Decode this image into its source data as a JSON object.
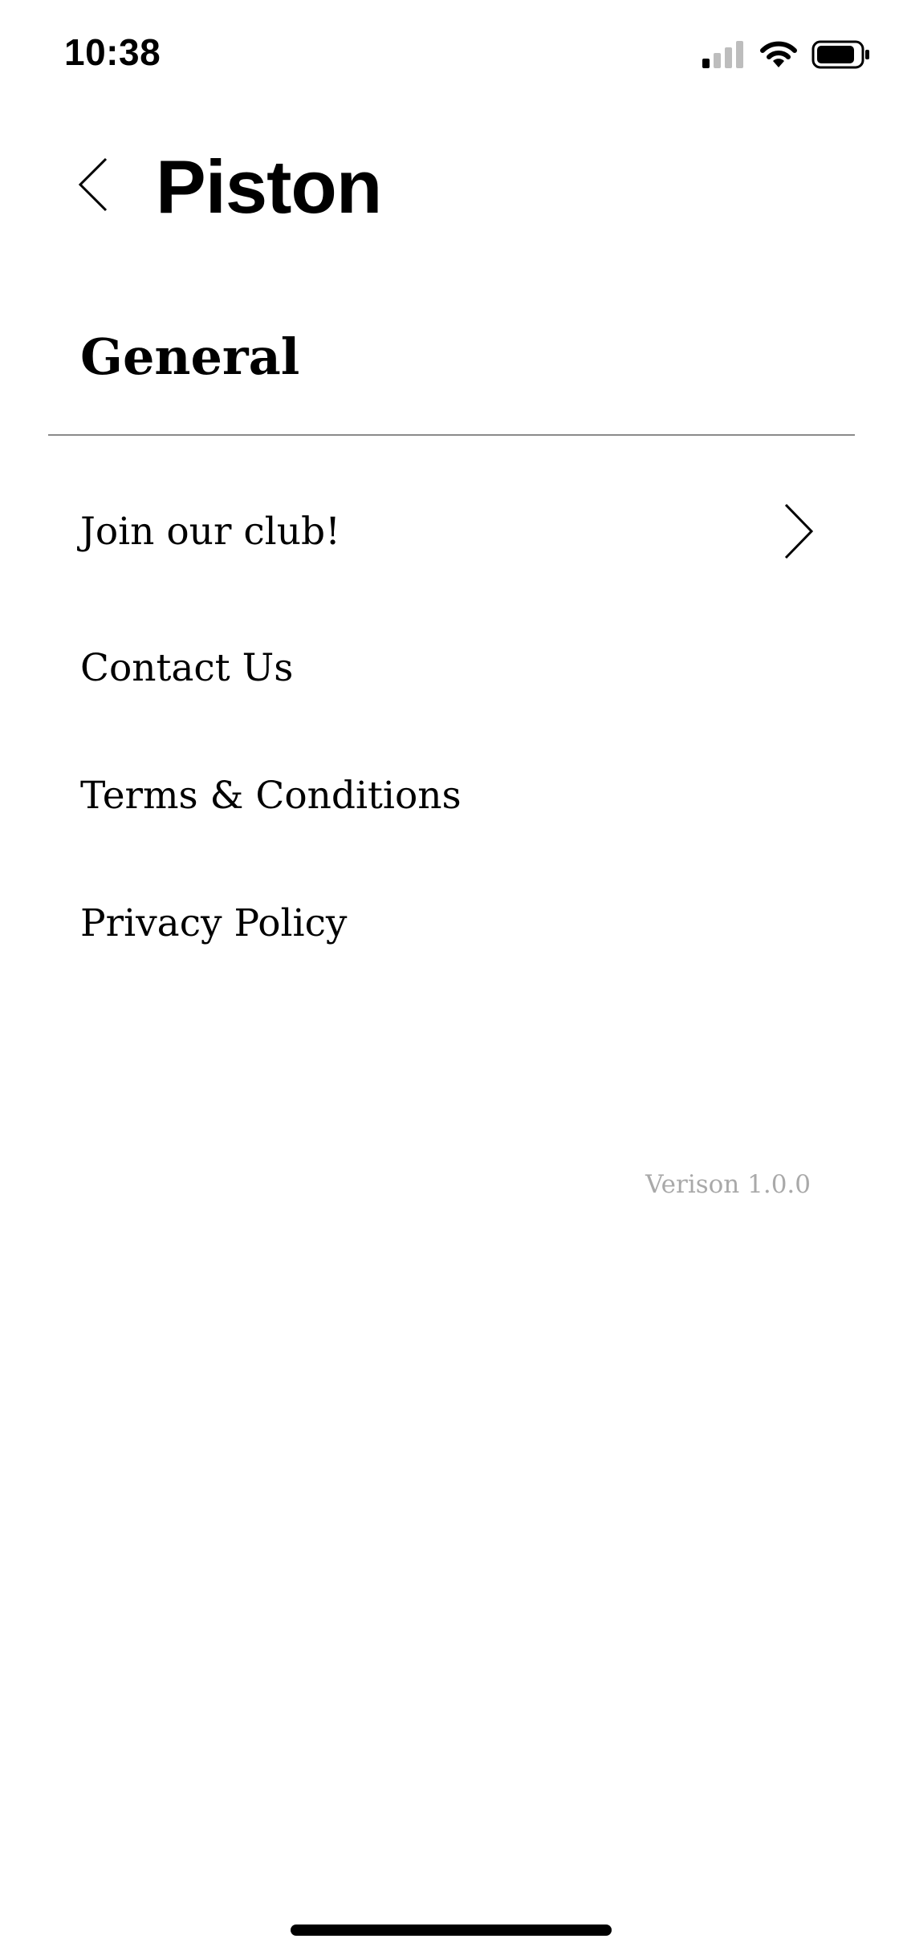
{
  "status_bar": {
    "time": "10:38",
    "icons": [
      "cellular-signal-icon",
      "wifi-icon",
      "battery-icon"
    ]
  },
  "header": {
    "back_icon": "chevron-left-icon",
    "title": "Piston"
  },
  "section": {
    "title": "General"
  },
  "menu": {
    "items": [
      {
        "label": "Join our club!",
        "icon": "chevron-right-icon"
      },
      {
        "label": "Contact Us"
      },
      {
        "label": "Terms & Conditions"
      },
      {
        "label": "Privacy Policy"
      }
    ]
  },
  "footer": {
    "version": "Verison 1.0.0"
  },
  "colors": {
    "background": "#ffffff",
    "text": "#000000",
    "divider": "#8a8a8a",
    "version_text": "#a9a9a9"
  }
}
